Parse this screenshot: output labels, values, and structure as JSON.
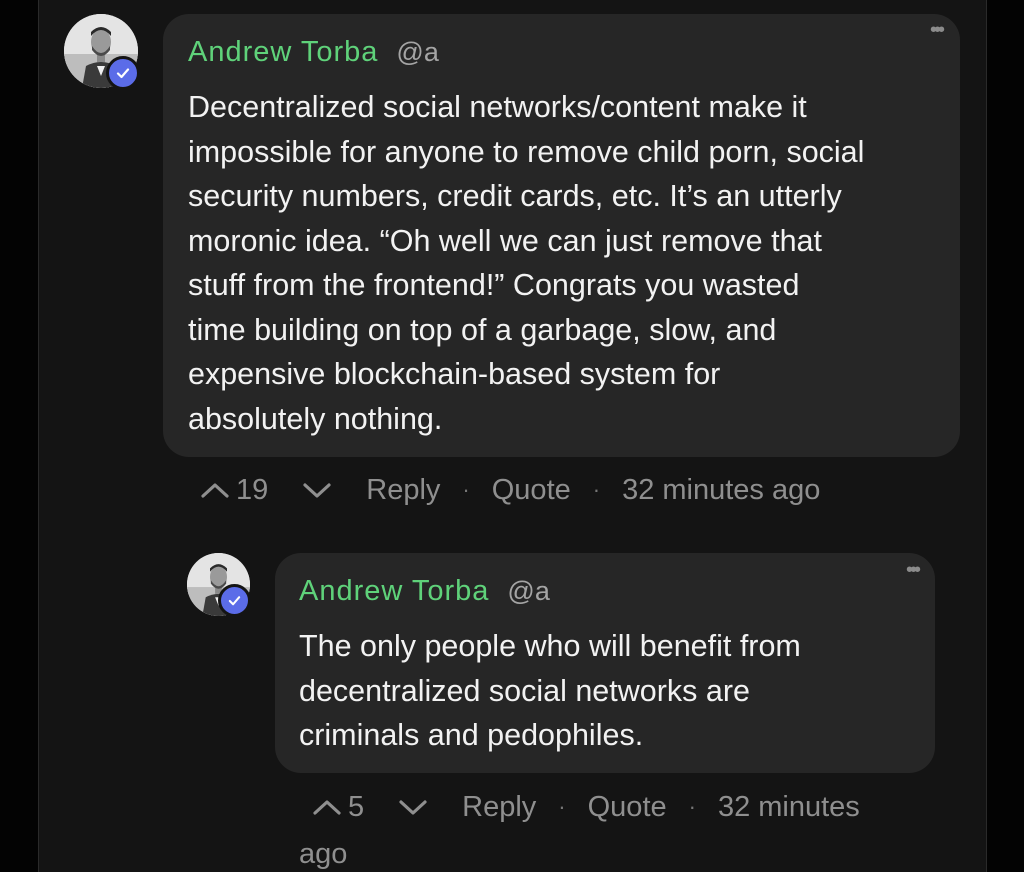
{
  "comments": [
    {
      "author": "Andrew Torba",
      "handle": "@a",
      "lines": [
        "Decentralized social networks/content make it",
        "impossible for anyone to remove child porn, social",
        "security numbers, credit cards, etc. It’s an utterly",
        "moronic idea. “Oh well we can just remove that",
        "stuff from the frontend!” Congrats you wasted",
        "time building on top of a garbage, slow, and",
        "expensive blockchain-based system for",
        "absolutely nothing."
      ],
      "score": "19",
      "reply_label": "Reply",
      "quote_label": "Quote",
      "timestamp": "32 minutes ago",
      "separator": "·",
      "more_glyph": "•••"
    },
    {
      "author": "Andrew Torba",
      "handle": "@a",
      "lines": [
        "The only people who will benefit from",
        "decentralized social networks are",
        "criminals and pedophiles."
      ],
      "score": "5",
      "reply_label": "Reply",
      "quote_label": "Quote",
      "timestamp_line1": "32 minutes",
      "timestamp_line2": "ago",
      "separator": "·",
      "more_glyph": "•••"
    }
  ],
  "icons": {
    "upvote": "chevron-up-icon",
    "downvote": "chevron-down-icon",
    "verified": "checkmark-icon",
    "more": "more-dots-icon"
  },
  "colors": {
    "author": "#5fd27a",
    "verified_badge": "#5b6ce8",
    "bubble": "#262626",
    "background": "#141414"
  }
}
